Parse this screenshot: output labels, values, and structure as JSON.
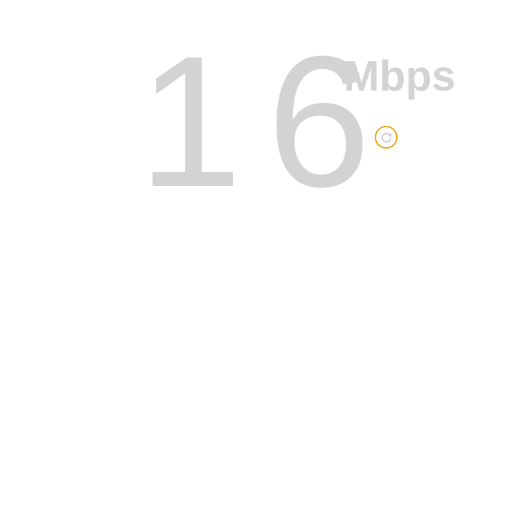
{
  "speed": {
    "value": "16",
    "unit": "Mbps"
  },
  "refresh": {
    "icon": "refresh-icon",
    "ring_color": "#e5a50a",
    "icon_color": "#c8c8c8"
  },
  "colors": {
    "text": "#d3d3d3",
    "background": "#ffffff"
  }
}
